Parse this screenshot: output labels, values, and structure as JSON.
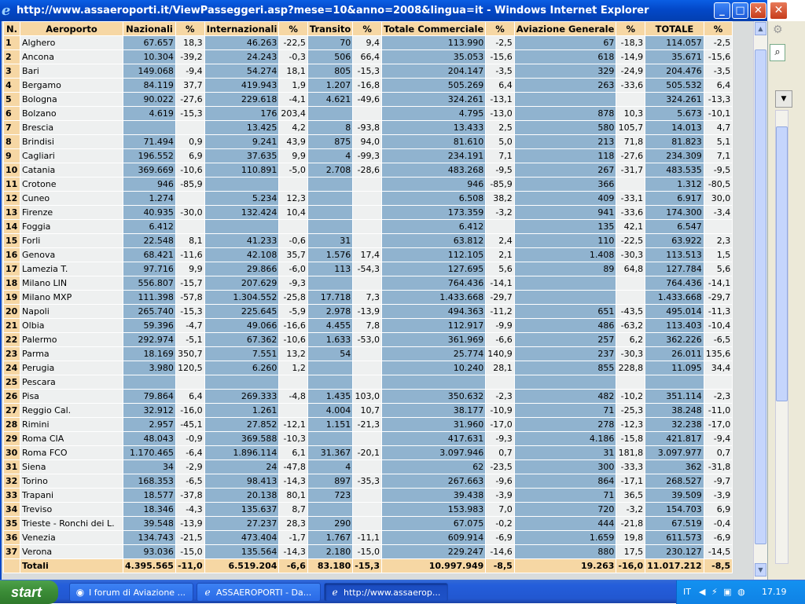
{
  "window": {
    "title": "http://www.assaeroporti.it/ViewPasseggeri.asp?mese=10&anno=2008&lingua=it - Windows Internet Explorer",
    "icon": "ie-icon",
    "min_label": "_",
    "max_label": "□",
    "close_label": "✕"
  },
  "table": {
    "headers": [
      "N.",
      "Aeroporto",
      "Nazionali",
      "%",
      "Internazionali",
      "%",
      "Transito",
      "%",
      "Totale Commerciale",
      "%",
      "Aviazione Generale",
      "%",
      "TOTALE",
      "%"
    ],
    "rows": [
      [
        "1",
        "Alghero",
        "67.657",
        "18,3",
        "46.263",
        "-22,5",
        "70",
        "9,4",
        "113.990",
        "-2,5",
        "67",
        "-18,3",
        "114.057",
        "-2,5"
      ],
      [
        "2",
        "Ancona",
        "10.304",
        "-39,2",
        "24.243",
        "-0,3",
        "506",
        "66,4",
        "35.053",
        "-15,6",
        "618",
        "-14,9",
        "35.671",
        "-15,6"
      ],
      [
        "3",
        "Bari",
        "149.068",
        "-9,4",
        "54.274",
        "18,1",
        "805",
        "-15,3",
        "204.147",
        "-3,5",
        "329",
        "-24,9",
        "204.476",
        "-3,5"
      ],
      [
        "4",
        "Bergamo",
        "84.119",
        "37,7",
        "419.943",
        "1,9",
        "1.207",
        "-16,8",
        "505.269",
        "6,4",
        "263",
        "-33,6",
        "505.532",
        "6,4"
      ],
      [
        "5",
        "Bologna",
        "90.022",
        "-27,6",
        "229.618",
        "-4,1",
        "4.621",
        "-49,6",
        "324.261",
        "-13,1",
        "",
        "",
        "324.261",
        "-13,3"
      ],
      [
        "6",
        "Bolzano",
        "4.619",
        "-15,3",
        "176",
        "203,4",
        "",
        "",
        "4.795",
        "-13,0",
        "878",
        "10,3",
        "5.673",
        "-10,1"
      ],
      [
        "7",
        "Brescia",
        "",
        "",
        "13.425",
        "4,2",
        "8",
        "-93,8",
        "13.433",
        "2,5",
        "580",
        "105,7",
        "14.013",
        "4,7"
      ],
      [
        "8",
        "Brindisi",
        "71.494",
        "0,9",
        "9.241",
        "43,9",
        "875",
        "94,0",
        "81.610",
        "5,0",
        "213",
        "71,8",
        "81.823",
        "5,1"
      ],
      [
        "9",
        "Cagliari",
        "196.552",
        "6,9",
        "37.635",
        "9,9",
        "4",
        "-99,3",
        "234.191",
        "7,1",
        "118",
        "-27,6",
        "234.309",
        "7,1"
      ],
      [
        "10",
        "Catania",
        "369.669",
        "-10,6",
        "110.891",
        "-5,0",
        "2.708",
        "-28,6",
        "483.268",
        "-9,5",
        "267",
        "-31,7",
        "483.535",
        "-9,5"
      ],
      [
        "11",
        "Crotone",
        "946",
        "-85,9",
        "",
        "",
        "",
        "",
        "946",
        "-85,9",
        "366",
        "",
        "1.312",
        "-80,5"
      ],
      [
        "12",
        "Cuneo",
        "1.274",
        "",
        "5.234",
        "12,3",
        "",
        "",
        "6.508",
        "38,2",
        "409",
        "-33,1",
        "6.917",
        "30,0"
      ],
      [
        "13",
        "Firenze",
        "40.935",
        "-30,0",
        "132.424",
        "10,4",
        "",
        "",
        "173.359",
        "-3,2",
        "941",
        "-33,6",
        "174.300",
        "-3,4"
      ],
      [
        "14",
        "Foggia",
        "6.412",
        "",
        "",
        "",
        "",
        "",
        "6.412",
        "",
        "135",
        "42,1",
        "6.547",
        ""
      ],
      [
        "15",
        "Forli",
        "22.548",
        "8,1",
        "41.233",
        "-0,6",
        "31",
        "",
        "63.812",
        "2,4",
        "110",
        "-22,5",
        "63.922",
        "2,3"
      ],
      [
        "16",
        "Genova",
        "68.421",
        "-11,6",
        "42.108",
        "35,7",
        "1.576",
        "17,4",
        "112.105",
        "2,1",
        "1.408",
        "-30,3",
        "113.513",
        "1,5"
      ],
      [
        "17",
        "Lamezia T.",
        "97.716",
        "9,9",
        "29.866",
        "-6,0",
        "113",
        "-54,3",
        "127.695",
        "5,6",
        "89",
        "64,8",
        "127.784",
        "5,6"
      ],
      [
        "18",
        "Milano LIN",
        "556.807",
        "-15,7",
        "207.629",
        "-9,3",
        "",
        "",
        "764.436",
        "-14,1",
        "",
        "",
        "764.436",
        "-14,1"
      ],
      [
        "19",
        "Milano MXP",
        "111.398",
        "-57,8",
        "1.304.552",
        "-25,8",
        "17.718",
        "7,3",
        "1.433.668",
        "-29,7",
        "",
        "",
        "1.433.668",
        "-29,7"
      ],
      [
        "20",
        "Napoli",
        "265.740",
        "-15,3",
        "225.645",
        "-5,9",
        "2.978",
        "-13,9",
        "494.363",
        "-11,2",
        "651",
        "-43,5",
        "495.014",
        "-11,3"
      ],
      [
        "21",
        "Olbia",
        "59.396",
        "-4,7",
        "49.066",
        "-16,6",
        "4.455",
        "7,8",
        "112.917",
        "-9,9",
        "486",
        "-63,2",
        "113.403",
        "-10,4"
      ],
      [
        "22",
        "Palermo",
        "292.974",
        "-5,1",
        "67.362",
        "-10,6",
        "1.633",
        "-53,0",
        "361.969",
        "-6,6",
        "257",
        "6,2",
        "362.226",
        "-6,5"
      ],
      [
        "23",
        "Parma",
        "18.169",
        "350,7",
        "7.551",
        "13,2",
        "54",
        "",
        "25.774",
        "140,9",
        "237",
        "-30,3",
        "26.011",
        "135,6"
      ],
      [
        "24",
        "Perugia",
        "3.980",
        "120,5",
        "6.260",
        "1,2",
        "",
        "",
        "10.240",
        "28,1",
        "855",
        "228,8",
        "11.095",
        "34,4"
      ],
      [
        "25",
        "Pescara",
        "",
        "",
        "",
        "",
        "",
        "",
        "",
        "",
        "",
        "",
        "",
        ""
      ],
      [
        "26",
        "Pisa",
        "79.864",
        "6,4",
        "269.333",
        "-4,8",
        "1.435",
        "103,0",
        "350.632",
        "-2,3",
        "482",
        "-10,2",
        "351.114",
        "-2,3"
      ],
      [
        "27",
        "Reggio Cal.",
        "32.912",
        "-16,0",
        "1.261",
        "",
        "4.004",
        "10,7",
        "38.177",
        "-10,9",
        "71",
        "-25,3",
        "38.248",
        "-11,0"
      ],
      [
        "28",
        "Rimini",
        "2.957",
        "-45,1",
        "27.852",
        "-12,1",
        "1.151",
        "-21,3",
        "31.960",
        "-17,0",
        "278",
        "-12,3",
        "32.238",
        "-17,0"
      ],
      [
        "29",
        "Roma CIA",
        "48.043",
        "-0,9",
        "369.588",
        "-10,3",
        "",
        "",
        "417.631",
        "-9,3",
        "4.186",
        "-15,8",
        "421.817",
        "-9,4"
      ],
      [
        "30",
        "Roma FCO",
        "1.170.465",
        "-6,4",
        "1.896.114",
        "6,1",
        "31.367",
        "-20,1",
        "3.097.946",
        "0,7",
        "31",
        "181,8",
        "3.097.977",
        "0,7"
      ],
      [
        "31",
        "Siena",
        "34",
        "-2,9",
        "24",
        "-47,8",
        "4",
        "",
        "62",
        "-23,5",
        "300",
        "-33,3",
        "362",
        "-31,8"
      ],
      [
        "32",
        "Torino",
        "168.353",
        "-6,5",
        "98.413",
        "-14,3",
        "897",
        "-35,3",
        "267.663",
        "-9,6",
        "864",
        "-17,1",
        "268.527",
        "-9,7"
      ],
      [
        "33",
        "Trapani",
        "18.577",
        "-37,8",
        "20.138",
        "80,1",
        "723",
        "",
        "39.438",
        "-3,9",
        "71",
        "36,5",
        "39.509",
        "-3,9"
      ],
      [
        "34",
        "Treviso",
        "18.346",
        "-4,3",
        "135.637",
        "8,7",
        "",
        "",
        "153.983",
        "7,0",
        "720",
        "-3,2",
        "154.703",
        "6,9"
      ],
      [
        "35",
        "Trieste - Ronchi dei L.",
        "39.548",
        "-13,9",
        "27.237",
        "28,3",
        "290",
        "",
        "67.075",
        "-0,2",
        "444",
        "-21,8",
        "67.519",
        "-0,4"
      ],
      [
        "36",
        "Venezia",
        "134.743",
        "-21,5",
        "473.404",
        "-1,7",
        "1.767",
        "-11,1",
        "609.914",
        "-6,9",
        "1.659",
        "19,8",
        "611.573",
        "-6,9"
      ],
      [
        "37",
        "Verona",
        "93.036",
        "-15,0",
        "135.564",
        "-14,3",
        "2.180",
        "-15,0",
        "229.247",
        "-14,6",
        "880",
        "17,5",
        "230.127",
        "-14,5"
      ]
    ],
    "totals": [
      "",
      "Totali",
      "4.395.565",
      "-11,0",
      "6.519.204",
      "-6,6",
      "83.180",
      "-15,3",
      "10.997.949",
      "-8,5",
      "19.263",
      "-16,0",
      "11.017.212",
      "-8,5"
    ]
  },
  "taskbar": {
    "start_label": "start",
    "tasks": [
      {
        "label": "I forum di Aviazione ...",
        "icon": "firefox-icon",
        "active": false
      },
      {
        "label": "ASSAEROPORTI - Da...",
        "icon": "ie-icon",
        "active": false
      },
      {
        "label": "http://www.assaerop...",
        "icon": "ie-icon",
        "active": true
      }
    ],
    "lang": "IT",
    "clock": "17.19"
  }
}
